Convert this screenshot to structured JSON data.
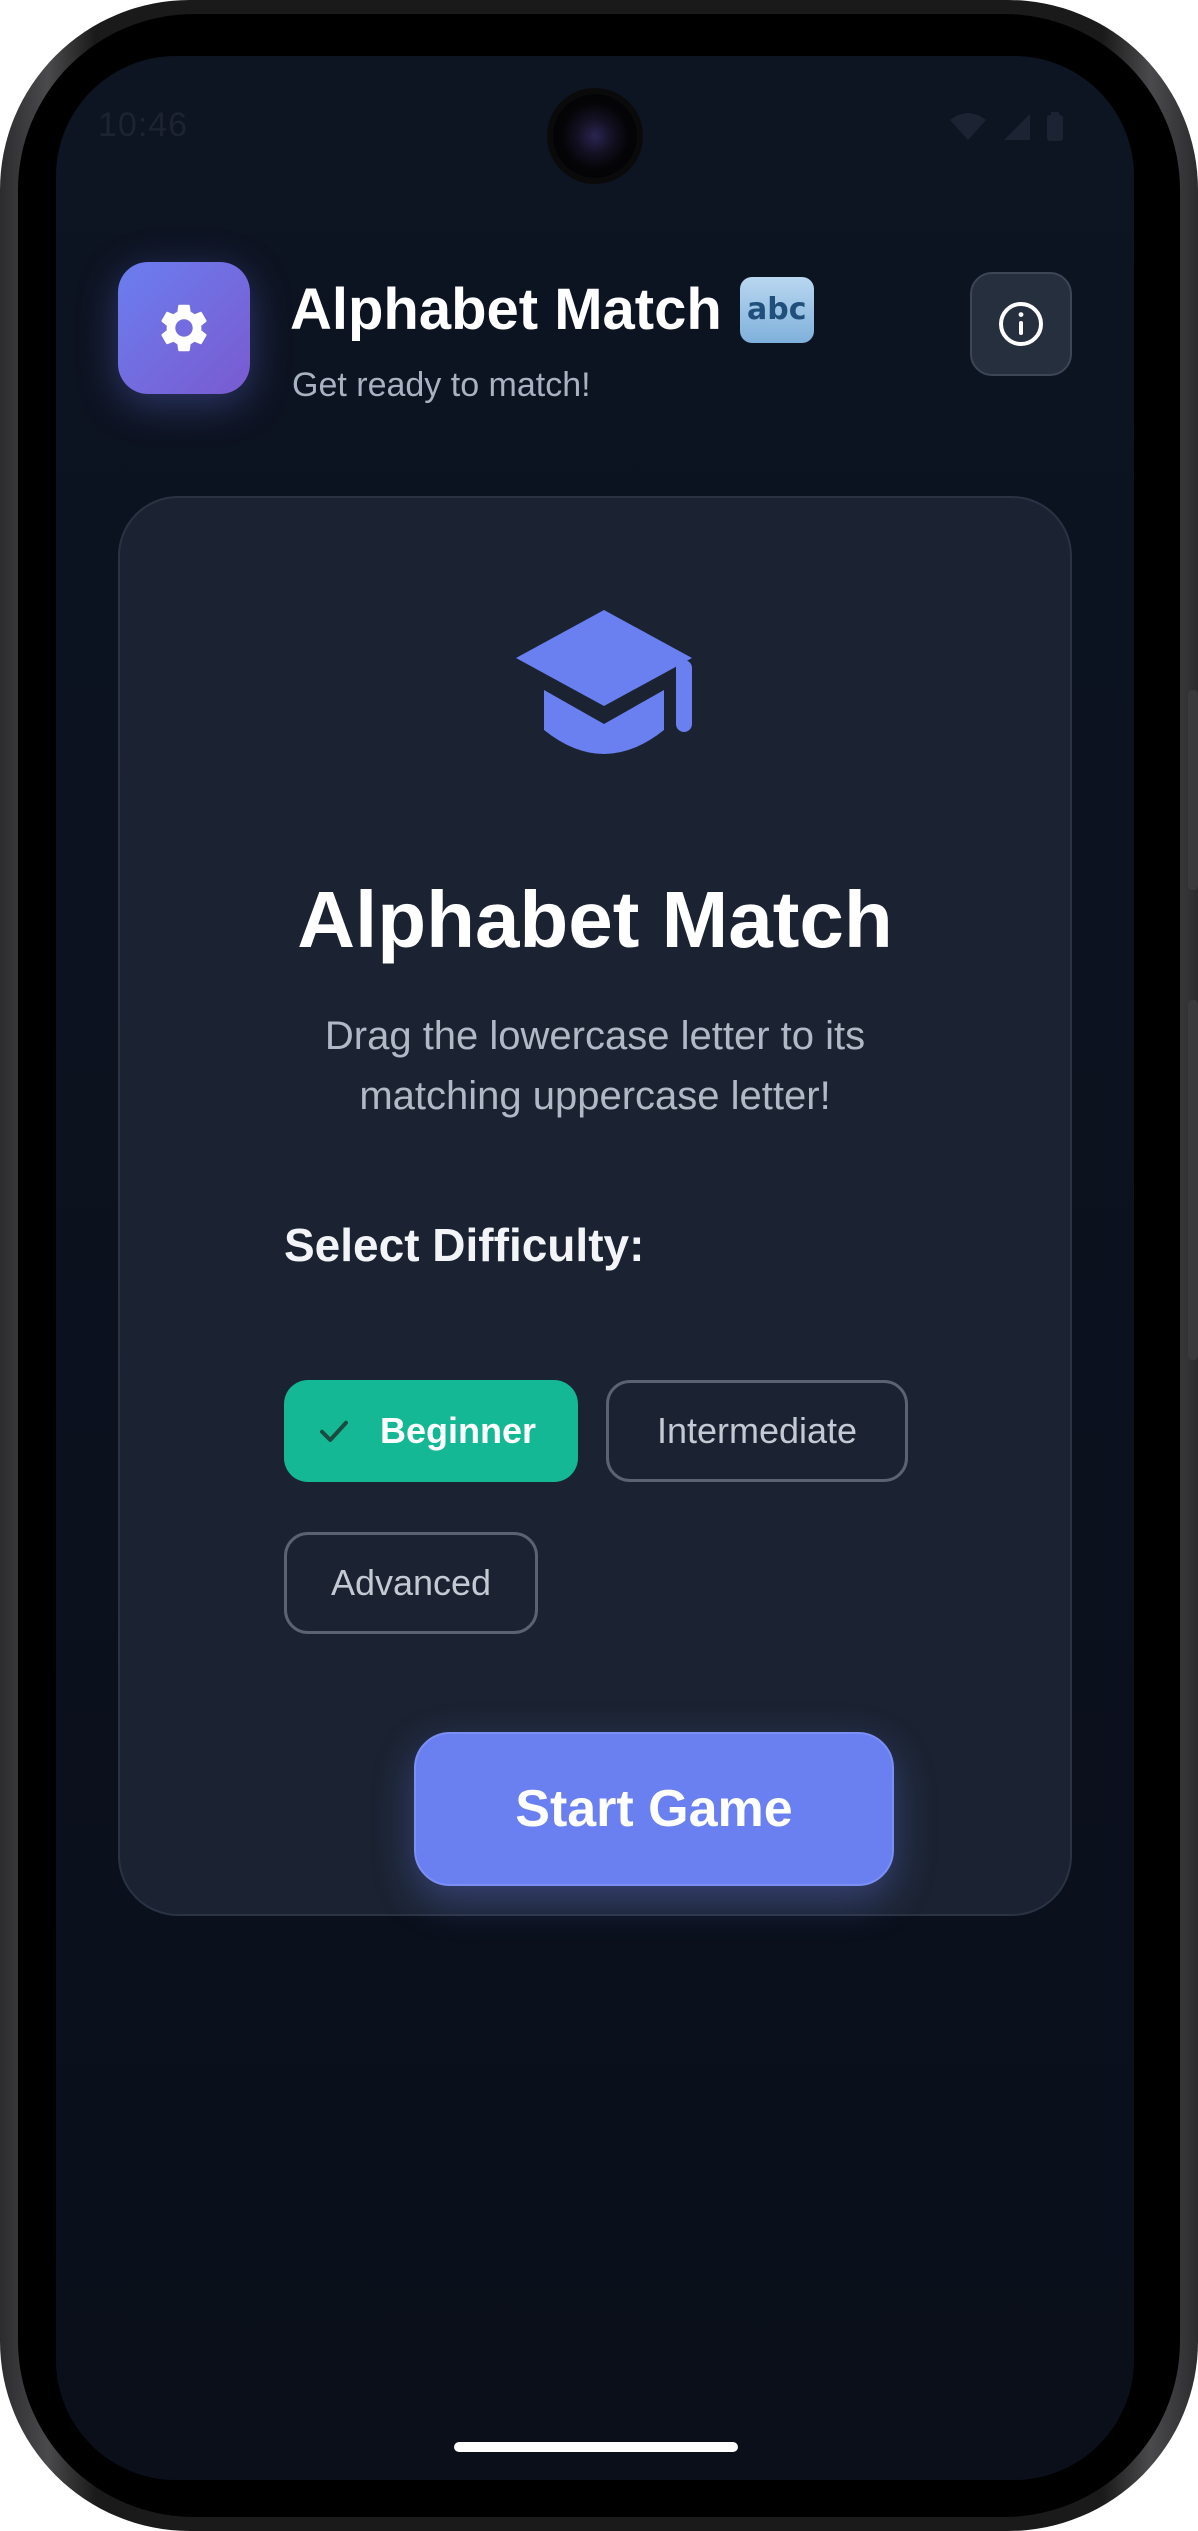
{
  "status_bar": {
    "time": "10:46",
    "icons": [
      "wifi-icon",
      "signal-icon",
      "battery-icon"
    ]
  },
  "header": {
    "app_icon": "gear-icon",
    "title": "Alphabet Match",
    "title_emoji": "abc",
    "subtitle": "Get ready to match!",
    "info_icon": "info-icon"
  },
  "card": {
    "icon": "graduation-cap-icon",
    "title": "Alphabet Match",
    "description": "Drag the lowercase letter to its matching uppercase letter!",
    "difficulty_label": "Select Difficulty:",
    "difficulties": [
      {
        "label": "Beginner",
        "selected": true
      },
      {
        "label": "Intermediate",
        "selected": false
      },
      {
        "label": "Advanced",
        "selected": false
      }
    ],
    "start_label": "Start Game"
  },
  "colors": {
    "accent": "#6a7ff0",
    "selected_chip": "#14b895",
    "background": "#0d1422",
    "card": "#1b2332"
  }
}
